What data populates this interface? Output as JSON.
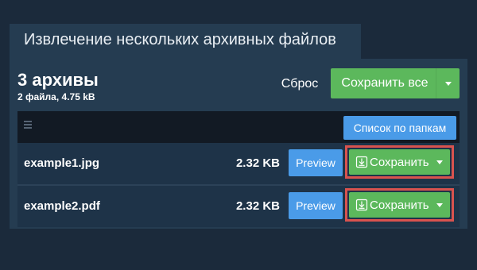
{
  "tab": {
    "title": "Извлечение нескольких архивных файлов"
  },
  "summary": {
    "title": "3 архивы",
    "subtitle": "2 файла, 4.75 kB"
  },
  "actions": {
    "reset_label": "Сброс",
    "save_all_label": "Сохранить все"
  },
  "toolbar": {
    "folder_view_label": "Список по папкам"
  },
  "files": [
    {
      "name": "example1.jpg",
      "size": "2.32 KB",
      "preview_label": "Preview",
      "save_label": "Сохранить"
    },
    {
      "name": "example2.pdf",
      "size": "2.32 KB",
      "preview_label": "Preview",
      "save_label": "Сохранить"
    }
  ],
  "colors": {
    "background": "#1b2a3b",
    "panel": "#253c51",
    "primary_blue": "#4a9be8",
    "success_green": "#5cb85c",
    "highlight_red": "#d9534f"
  },
  "icons": {
    "menu": "hamburger-menu-icon",
    "save": "download-icon",
    "dropdown": "caret-down-icon"
  }
}
